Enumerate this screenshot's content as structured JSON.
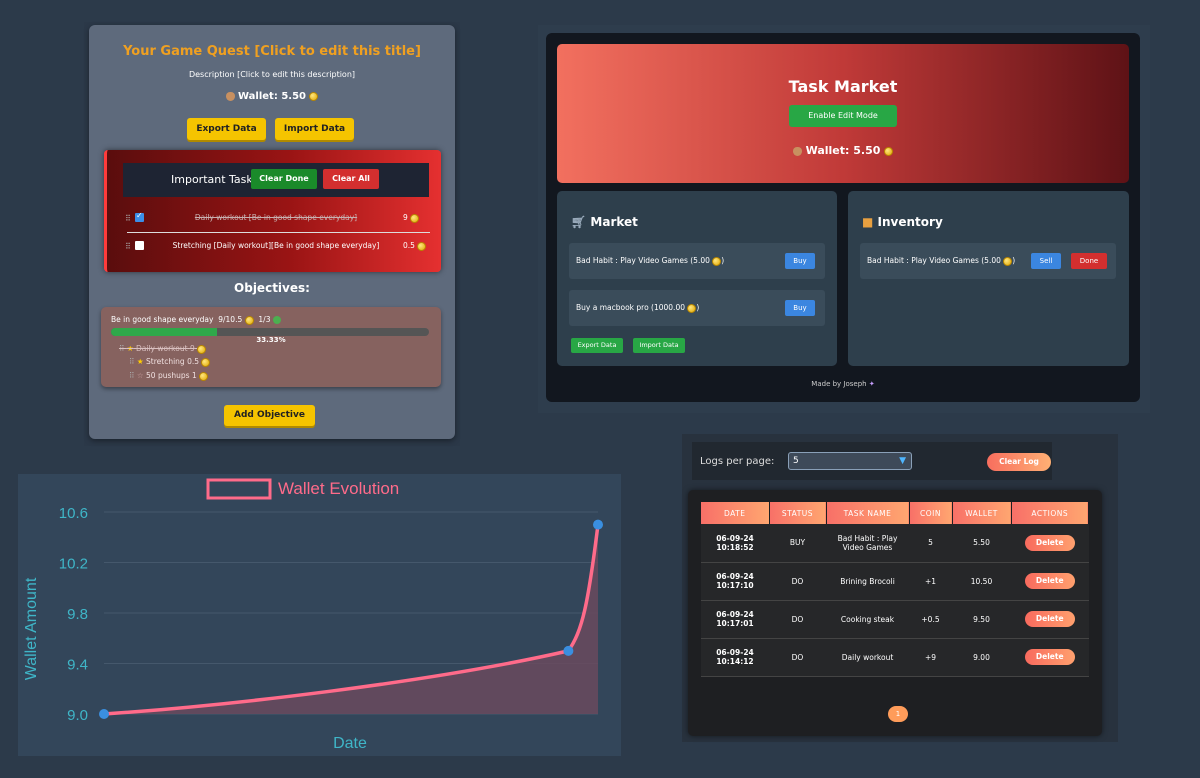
{
  "quest": {
    "title": "Your Game Quest [Click to edit this title]",
    "description": "Description [Click to edit this description]",
    "wallet_label": "Wallet: 5.50",
    "export_label": "Export Data",
    "import_label": "Import Data",
    "important": {
      "title": "Important Task",
      "clear_done_label": "Clear Done",
      "clear_all_label": "Clear All",
      "tasks": [
        {
          "text": "Daily workout [Be in good shape everyday]",
          "value": "9",
          "done": true
        },
        {
          "text": "Stretching [Daily workout][Be in good shape everyday]",
          "value": "0.5",
          "done": false
        }
      ]
    },
    "objectives_title": "Objectives:",
    "objective": {
      "name": "Be in good shape everyday",
      "coins": "9/10.5",
      "count": "1/3",
      "percent": "33.33%",
      "progress": 0.3333,
      "subtasks": [
        {
          "text": "Daily workout",
          "value": "9",
          "done": true
        },
        {
          "text": "Stretching",
          "value": "0.5",
          "done": false
        },
        {
          "text": "50 pushups",
          "value": "1",
          "done": false
        }
      ]
    },
    "add_objective_label": "Add Objective"
  },
  "market": {
    "title": "Task Market",
    "edit_mode_label": "Enable Edit Mode",
    "wallet_label": "Wallet: 5.50",
    "market_title": "Market",
    "inventory_title": "Inventory",
    "market_items": [
      {
        "text": "Bad Habit : Play Video Games (5.00",
        "button": "Buy"
      },
      {
        "text": "Buy a macbook pro (1000.00",
        "button": "Buy"
      }
    ],
    "export_label": "Export Data",
    "import_label": "Import Data",
    "inventory_items": [
      {
        "text": "Bad Habit : Play Video Games (5.00",
        "sell_label": "Sell",
        "done_label": "Done"
      }
    ],
    "footer": "Made by Joseph"
  },
  "chart_data": {
    "type": "line",
    "title": "Wallet Evolution",
    "xlabel": "Date",
    "ylabel": "Wallet Amount",
    "ylim": [
      9.0,
      10.6
    ],
    "yticks": [
      "9.0",
      "9.4",
      "9.8",
      "10.2",
      "10.6"
    ],
    "series": [
      {
        "name": "Wallet Evolution",
        "x": [
          0,
          0.94,
          1.0
        ],
        "values": [
          9.0,
          9.5,
          10.5
        ]
      }
    ],
    "colors": {
      "line": "#ff6b8a",
      "point": "#3a8fe0",
      "fill": "#6a4a5e"
    }
  },
  "logs": {
    "per_page_label": "Logs per page:",
    "per_page_value": "5",
    "clear_label": "Clear Log",
    "columns": [
      "DATE",
      "STATUS",
      "TASK NAME",
      "COIN",
      "WALLET",
      "ACTIONS"
    ],
    "rows": [
      {
        "date": "06-09-24 10:18:52",
        "status": "BUY",
        "task": "Bad Habit : Play Video Games",
        "coin": "5",
        "wallet": "5.50",
        "action": "Delete"
      },
      {
        "date": "06-09-24 10:17:10",
        "status": "DO",
        "task": "Brining Brocoli",
        "coin": "+1",
        "wallet": "10.50",
        "action": "Delete"
      },
      {
        "date": "06-09-24 10:17:01",
        "status": "DO",
        "task": "Cooking steak",
        "coin": "+0.5",
        "wallet": "9.50",
        "action": "Delete"
      },
      {
        "date": "06-09-24 10:14:12",
        "status": "DO",
        "task": "Daily workout",
        "coin": "+9",
        "wallet": "9.00",
        "action": "Delete"
      }
    ],
    "page": "1"
  }
}
